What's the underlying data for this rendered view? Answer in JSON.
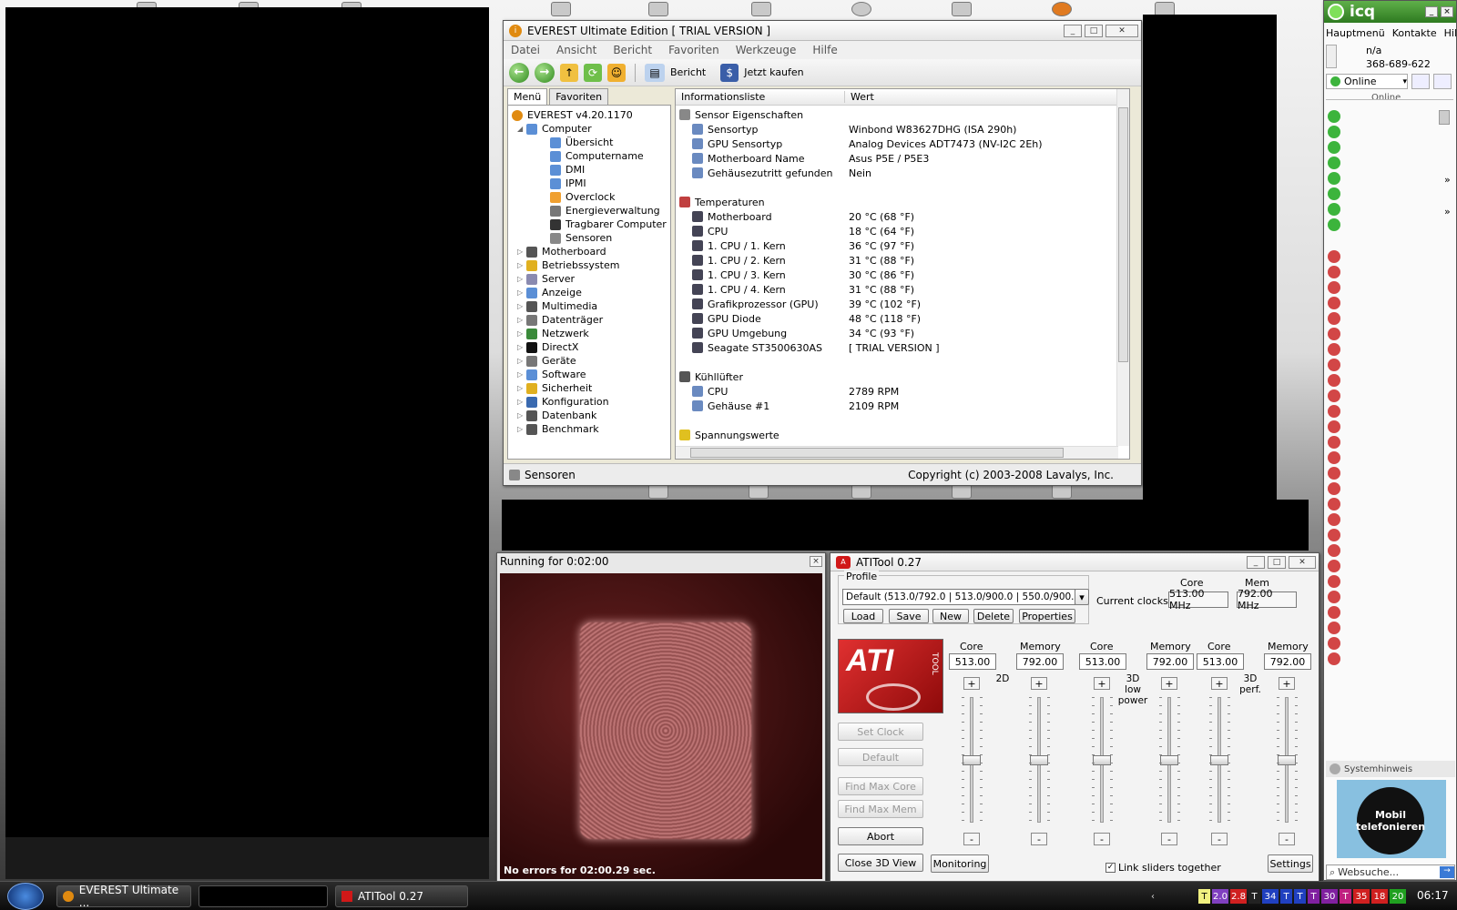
{
  "everest": {
    "title": "EVEREST Ultimate Edition  [ TRIAL VERSION ]",
    "menu": [
      "Datei",
      "Ansicht",
      "Bericht",
      "Favoriten",
      "Werkzeuge",
      "Hilfe"
    ],
    "toolbar": {
      "report": "Bericht",
      "buy": "Jetzt kaufen"
    },
    "tabs": {
      "menu": "Menü",
      "favorites": "Favoriten"
    },
    "tree_root": "EVEREST v4.20.1170",
    "tree_computer": "Computer",
    "tree_computer_children": [
      "Übersicht",
      "Computername",
      "DMI",
      "IPMI",
      "Overclock",
      "Energieverwaltung",
      "Tragbarer Computer",
      "Sensoren"
    ],
    "tree_items": [
      "Motherboard",
      "Betriebssystem",
      "Server",
      "Anzeige",
      "Multimedia",
      "Datenträger",
      "Netzwerk",
      "DirectX",
      "Geräte",
      "Software",
      "Sicherheit",
      "Konfiguration",
      "Datenbank",
      "Benchmark"
    ],
    "list_headers": {
      "field": "Informationsliste",
      "value": "Wert"
    },
    "groups": {
      "sensor": {
        "title": "Sensor Eigenschaften",
        "rows": [
          {
            "k": "Sensortyp",
            "v": "Winbond W83627DHG  (ISA 290h)"
          },
          {
            "k": "GPU Sensortyp",
            "v": "Analog Devices ADT7473  (NV-I2C 2Eh)"
          },
          {
            "k": "Motherboard Name",
            "v": "Asus P5E / P5E3"
          },
          {
            "k": "Gehäusezutritt gefunden",
            "v": "Nein"
          }
        ]
      },
      "temps": {
        "title": "Temperaturen",
        "rows": [
          {
            "k": "Motherboard",
            "v": "20 °C  (68 °F)"
          },
          {
            "k": "CPU",
            "v": "18 °C  (64 °F)"
          },
          {
            "k": "1. CPU / 1. Kern",
            "v": "36 °C  (97 °F)"
          },
          {
            "k": "1. CPU / 2. Kern",
            "v": "31 °C  (88 °F)"
          },
          {
            "k": "1. CPU / 3. Kern",
            "v": "30 °C  (86 °F)"
          },
          {
            "k": "1. CPU / 4. Kern",
            "v": "31 °C  (88 °F)"
          },
          {
            "k": "Grafikprozessor (GPU)",
            "v": "39 °C  (102 °F)"
          },
          {
            "k": "GPU Diode",
            "v": "48 °C  (118 °F)"
          },
          {
            "k": "GPU Umgebung",
            "v": "34 °C  (93 °F)"
          },
          {
            "k": "Seagate ST3500630AS",
            "v": "[ TRIAL VERSION ]"
          }
        ]
      },
      "fans": {
        "title": "Kühllüfter",
        "rows": [
          {
            "k": "CPU",
            "v": "2789 RPM"
          },
          {
            "k": "Gehäuse #1",
            "v": "2109 RPM"
          }
        ]
      },
      "volts": {
        "title": "Spannungswerte"
      }
    },
    "status_left": "Sensoren",
    "status_right": "Copyright (c) 2003-2008 Lavalys, Inc."
  },
  "render3d": {
    "title": "Running for 0:02:00",
    "status": "No errors for 02:00.29 sec."
  },
  "atitool": {
    "title": "ATITool 0.27",
    "profile_label": "Profile",
    "profile_value": "Default (513.0/792.0 | 513.0/900.0 | 550.0/900.0)",
    "buttons": {
      "load": "Load",
      "save": "Save",
      "new": "New",
      "delete": "Delete",
      "properties": "Properties"
    },
    "current_clocks_label": "Current clocks:",
    "core_header": "Core",
    "mem_header": "Mem",
    "current_core": "513.00 MHz",
    "current_mem": "792.00 MHz",
    "logo_text": "ATI",
    "logo_sub": "TOOL",
    "side_buttons": {
      "set_clock": "Set Clock",
      "default": "Default",
      "find_max_core": "Find Max Core",
      "find_max_mem": "Find Max Mem",
      "abort": "Abort",
      "close3d": "Close 3D View"
    },
    "monitoring": "Monitoring",
    "link_sliders": "Link sliders together",
    "settings": "Settings",
    "groups": [
      {
        "label": "2D",
        "core_label": "Core",
        "mem_label": "Memory",
        "core": "513.00",
        "mem": "792.00",
        "core_level": 0.5,
        "mem_level": 0.5
      },
      {
        "label": "3D low power",
        "core_label": "Core",
        "mem_label": "Memory",
        "core": "513.00",
        "mem": "792.00",
        "core_level": 0.5,
        "mem_level": 0.5
      },
      {
        "label": "3D perf.",
        "core_label": "Core",
        "mem_label": "Memory",
        "core": "513.00",
        "mem": "792.00",
        "core_level": 0.5,
        "mem_level": 0.5
      }
    ]
  },
  "icq": {
    "title": "icq",
    "menu": [
      "Hauptmenü",
      "Kontakte",
      "Hilfe"
    ],
    "status_na": "n/a",
    "uin": "368-689-622",
    "status_dropdown": "Online",
    "online_header": "Online",
    "sys_label": "Systemhinweis",
    "ad_text": "Mobil telefonieren",
    "search_placeholder": "Websuche...",
    "online_count": 8,
    "offline_count": 27
  },
  "taskbar": {
    "items": [
      "EVEREST Ultimate ...",
      "ATITool 0.27"
    ],
    "tray": [
      "T",
      "2.0",
      "2.8",
      "T",
      "34",
      "T",
      "T",
      "T",
      "30",
      "T",
      "35",
      "18",
      "20"
    ],
    "clock": "06:17"
  },
  "colors": {
    "online_green": "#3cb43c",
    "offline_red": "#d24646",
    "ati_red": "#d01818",
    "render_bg": "#5a1a1a"
  }
}
